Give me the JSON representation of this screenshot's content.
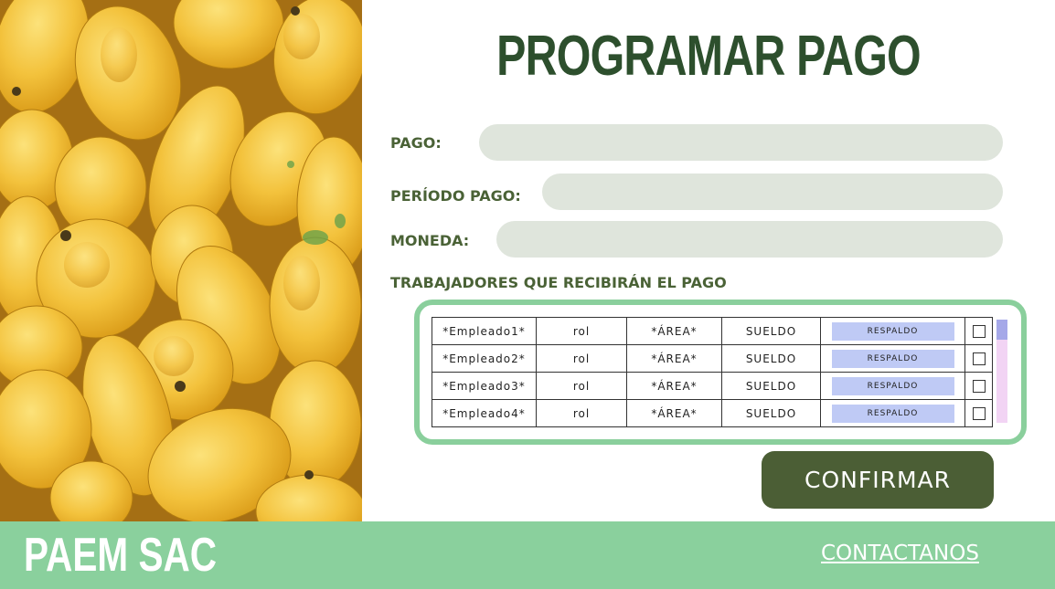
{
  "page": {
    "title": "PROGRAMAR PAGO"
  },
  "form": {
    "pago_label": "PAGO:",
    "pago_value": "",
    "periodo_label": "PERÍODO PAGO:",
    "periodo_value": "",
    "moneda_label": "MONEDA:",
    "moneda_value": ""
  },
  "workers": {
    "heading": "TRABAJADORES QUE RECIBIRÁN EL PAGO",
    "rows": [
      {
        "employee": "*Empleado1*",
        "role": "rol",
        "area": "*ÁREA*",
        "salary": "SUELDO",
        "backup": "RESPALDO",
        "checked": false
      },
      {
        "employee": "*Empleado2*",
        "role": "rol",
        "area": "*ÁREA*",
        "salary": "SUELDO",
        "backup": "RESPALDO",
        "checked": false
      },
      {
        "employee": "*Empleado3*",
        "role": "rol",
        "area": "*ÁREA*",
        "salary": "SUELDO",
        "backup": "RESPALDO",
        "checked": false
      },
      {
        "employee": "*Empleado4*",
        "role": "rol",
        "area": "*ÁREA*",
        "salary": "SUELDO",
        "backup": "RESPALDO",
        "checked": false
      }
    ]
  },
  "actions": {
    "confirm_label": "CONFIRMAR"
  },
  "footer": {
    "brand": "PAEM SAC",
    "contact_label": "CONTACTANOS"
  },
  "colors": {
    "title": "#2d4f2d",
    "label": "#4a6236",
    "field_bg": "#dfe5dc",
    "panel_border": "#8acf9c",
    "backup_button": "#bfcaf5",
    "confirm_button": "#4b5e35",
    "footer_bg": "#8ad09d"
  },
  "icons": {
    "hero": "mango-photo",
    "row_check": "checkbox-icon"
  }
}
